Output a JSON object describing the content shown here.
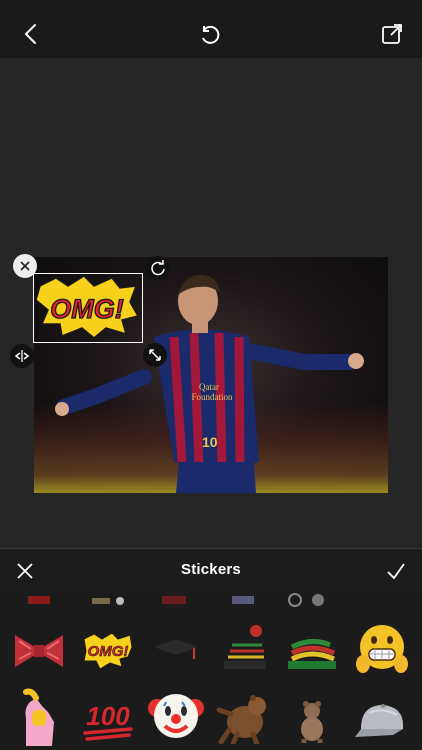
{
  "header": {
    "back_icon": "chevron-left-icon",
    "undo_icon": "rotate-ccw-icon",
    "share_icon": "share-square-icon"
  },
  "editor": {
    "sticker_text": "OMG!",
    "handles": [
      "close-handle-icon",
      "rotate-handle-icon",
      "resize-handle-icon",
      "flip-handle-icon"
    ]
  },
  "panel": {
    "title": "Stickers",
    "cancel_icon": "x-icon",
    "confirm_icon": "check-icon"
  },
  "stickers": {
    "row1": [
      "bow-tie",
      "omg-speech",
      "grad-cap",
      "beanie-hat",
      "rasta-hat",
      "grimace-emoji"
    ],
    "row2": [
      "call-me-hand",
      "hundred-points",
      "clown-face",
      "bear",
      "small-bear",
      "cap"
    ],
    "omg_label": "OMG!",
    "hundred_label": "100"
  },
  "colors": {
    "accent": "#ffffff",
    "background": "#1f1f1f",
    "omg_red": "#e5232b",
    "omg_yellow": "#f7d11b"
  }
}
